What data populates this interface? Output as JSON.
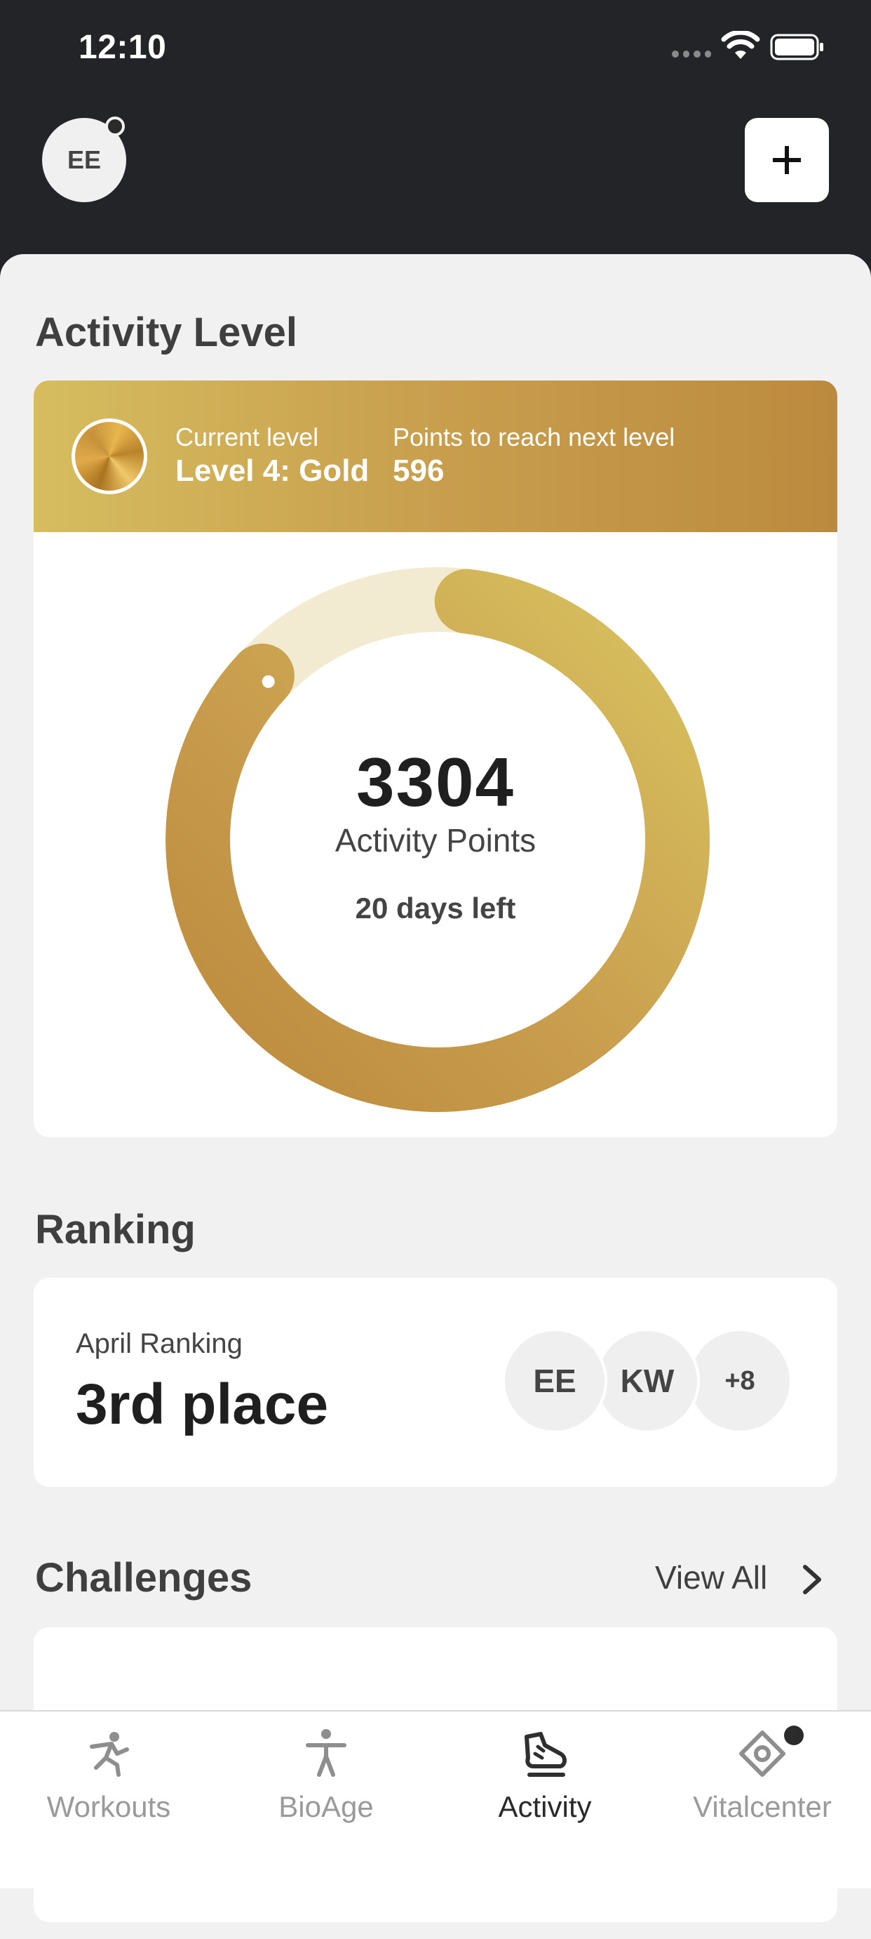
{
  "status_bar": {
    "time": "12:10"
  },
  "header": {
    "avatar_initials": "EE"
  },
  "activity_level": {
    "section_title": "Activity Level",
    "current_level_label": "Current level",
    "current_level_value": "Level 4: Gold",
    "next_level_label": "Points to reach next level",
    "next_level_value": "596",
    "points": "3304",
    "points_label": "Activity Points",
    "days_left": "20 days left",
    "progress_fraction": 0.85,
    "colors": {
      "gold_light": "#d8c25f",
      "gold_dark": "#bc8a3e",
      "track": "#f3ead2"
    }
  },
  "ranking": {
    "section_title": "Ranking",
    "month_label": "April Ranking",
    "place": "3rd place",
    "participants": [
      "EE",
      "KW"
    ],
    "more_count": "+8"
  },
  "challenges": {
    "section_title": "Challenges",
    "view_all_label": "View All"
  },
  "tabs": [
    {
      "label": "Workouts",
      "icon": "workouts-icon",
      "active": false
    },
    {
      "label": "BioAge",
      "icon": "bioage-icon",
      "active": false
    },
    {
      "label": "Activity",
      "icon": "activity-icon",
      "active": true
    },
    {
      "label": "Vitalcenter",
      "icon": "vitalcenter-icon",
      "active": false
    }
  ]
}
